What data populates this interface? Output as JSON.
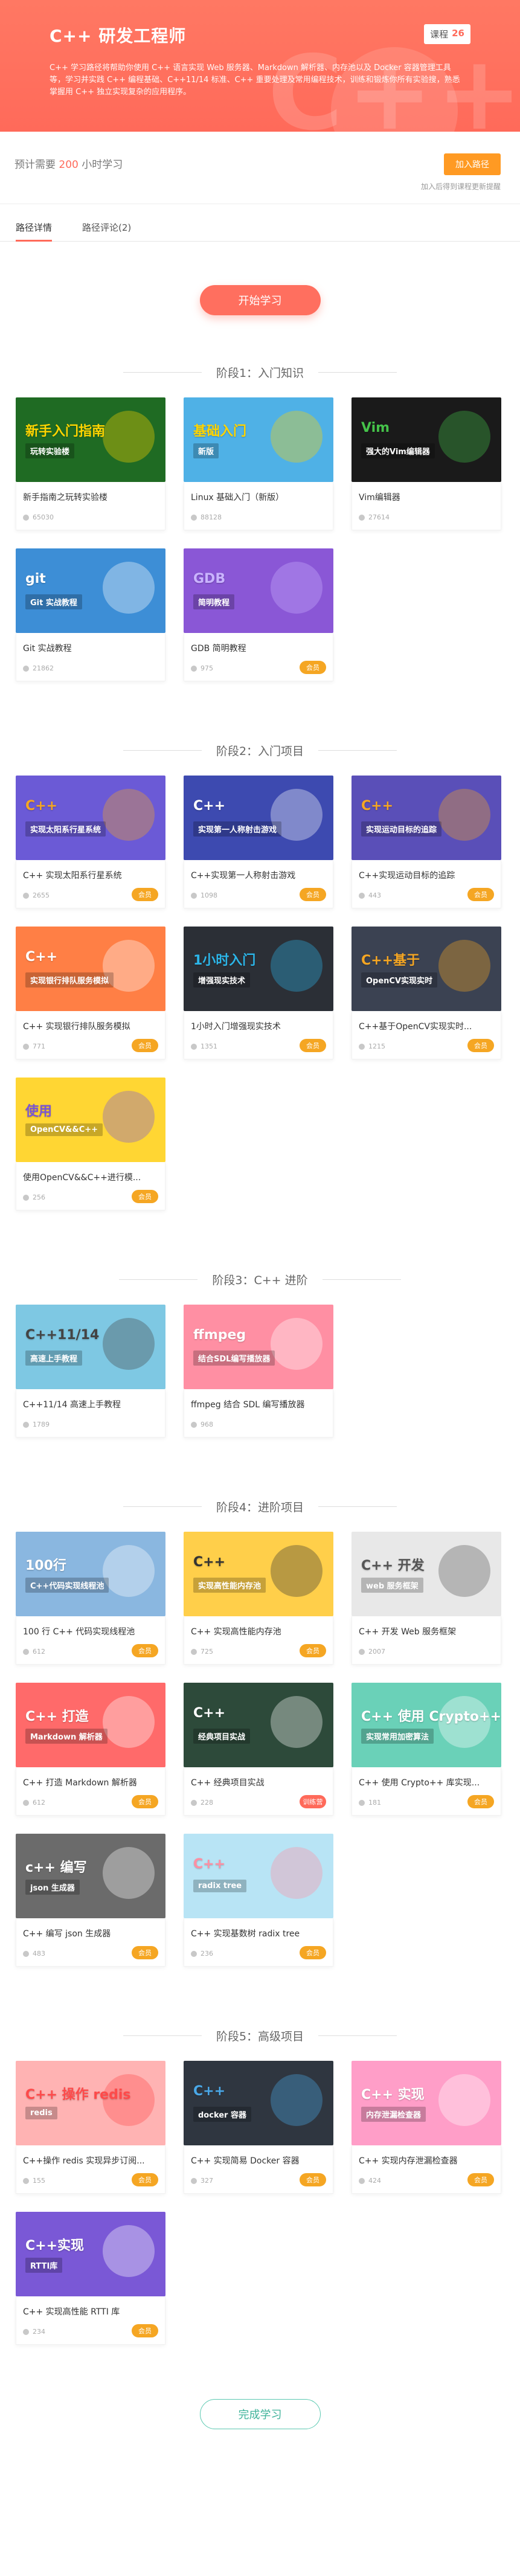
{
  "header": {
    "title": "C++ 研发工程师",
    "count_label": "课程",
    "count_value": "26",
    "description": "C++ 学习路径将帮助你使用 C++ 语言实现 Web 服务器、Markdown 解析器、内存池以及 Docker 容器管理工具等，学习并实践 C++ 编程基础、C++11/14 标准、C++ 重要处理及常用编程技术，训练和锻炼你所有实验搜，熟悉掌握用 C++ 独立实现复杂的应用程序。",
    "watermark": "C++"
  },
  "meta": {
    "estimate_prefix": "预计需要",
    "estimate_hours": "200",
    "estimate_suffix": "小时学习",
    "join_label": "加入路径",
    "join_note": "加入后得到课程更新提醒"
  },
  "tabs": [
    {
      "label": "路径详情",
      "active": true
    },
    {
      "label": "路径评论(2)",
      "active": false
    }
  ],
  "start_label": "开始学习",
  "done_label": "完成学习",
  "stages": [
    {
      "title": "阶段1：入门知识",
      "courses": [
        {
          "title": "新手指南之玩转实验楼",
          "users": "65030",
          "badge": "",
          "thumb": {
            "bg": "#1f6b23",
            "accent": "#ffd400",
            "text": "新手入门指南",
            "text2": "玩转实验楼"
          }
        },
        {
          "title": "Linux 基础入门（新版）",
          "users": "88128",
          "badge": "",
          "thumb": {
            "bg": "#4fb1e6",
            "accent": "#ffd400",
            "text": "基础入门",
            "text2": "新版"
          }
        },
        {
          "title": "Vim编辑器",
          "users": "27614",
          "badge": "",
          "thumb": {
            "bg": "#1a1a1a",
            "accent": "#45c24a",
            "text": "Vim",
            "text2": "强大的Vim编辑器"
          }
        },
        {
          "title": "Git 实战教程",
          "users": "21862",
          "badge": "",
          "thumb": {
            "bg": "#3d8ed6",
            "accent": "#ffffff",
            "text": "git",
            "text2": "Git 实战教程"
          }
        },
        {
          "title": "GDB 简明教程",
          "users": "975",
          "badge": "会员",
          "thumb": {
            "bg": "#8a57d6",
            "accent": "#c9b3ff",
            "text": "GDB",
            "text2": "简明教程"
          }
        }
      ]
    },
    {
      "title": "阶段2：入门项目",
      "courses": [
        {
          "title": "C++ 实现太阳系行星系统",
          "users": "2655",
          "badge": "会员",
          "thumb": {
            "bg": "#6b5ad6",
            "accent": "#f5a623",
            "text": "C++",
            "text2": "实现太阳系行星系统"
          }
        },
        {
          "title": "C++实现第一人称射击游戏",
          "users": "1098",
          "badge": "会员",
          "thumb": {
            "bg": "#3d4ab0",
            "accent": "#ffffff",
            "text": "C++",
            "text2": "实现第一人称射击游戏"
          }
        },
        {
          "title": "C++实现运动目标的追踪",
          "users": "443",
          "badge": "会员",
          "thumb": {
            "bg": "#5a4fb8",
            "accent": "#f5a623",
            "text": "C++",
            "text2": "实现运动目标的追踪"
          }
        },
        {
          "title": "C++ 实现银行排队服务模拟",
          "users": "771",
          "badge": "会员",
          "thumb": {
            "bg": "#ff7f45",
            "accent": "#ffffff",
            "text": "C++",
            "text2": "实现银行排队服务模拟"
          }
        },
        {
          "title": "1小时入门增强现实技术",
          "users": "1351",
          "badge": "会员",
          "thumb": {
            "bg": "#2b2f36",
            "accent": "#2cb5e8",
            "text": "1小时入门",
            "text2": "增强现实技术"
          }
        },
        {
          "title": "C++基于OpenCV实现实时...",
          "users": "1215",
          "badge": "会员",
          "thumb": {
            "bg": "#3b4252",
            "accent": "#f5a623",
            "text": "C++基于",
            "text2": "OpenCV实现实时"
          }
        },
        {
          "title": "使用OpenCV&&C++进行模...",
          "users": "256",
          "badge": "会员",
          "thumb": {
            "bg": "#ffd633",
            "accent": "#7a55d6",
            "text": "使用",
            "text2": "OpenCV&&C++"
          }
        }
      ]
    },
    {
      "title": "阶段3：C++ 进阶",
      "courses": [
        {
          "title": "C++11/14 高速上手教程",
          "users": "1789",
          "badge": "",
          "thumb": {
            "bg": "#7ec8e3",
            "accent": "#444444",
            "text": "C++11/14",
            "text2": "高速上手教程"
          }
        },
        {
          "title": "ffmpeg 结合 SDL 编写播放器",
          "users": "968",
          "badge": "",
          "thumb": {
            "bg": "#ff8fa3",
            "accent": "#ffffff",
            "text": "ffmpeg",
            "text2": "结合SDL编写播放器"
          }
        }
      ]
    },
    {
      "title": "阶段4：进阶项目",
      "courses": [
        {
          "title": "100 行 C++ 代码实现线程池",
          "users": "612",
          "badge": "会员",
          "thumb": {
            "bg": "#8ab7e0",
            "accent": "#ffffff",
            "text": "100行",
            "text2": "C++代码实现线程池"
          }
        },
        {
          "title": "C++ 实现高性能内存池",
          "users": "725",
          "badge": "会员",
          "thumb": {
            "bg": "#ffcf4a",
            "accent": "#333333",
            "text": "C++",
            "text2": "实现高性能内存池"
          }
        },
        {
          "title": "C++ 开发 Web 服务框架",
          "users": "2007",
          "badge": "",
          "thumb": {
            "bg": "#e8e8e8",
            "accent": "#555555",
            "text": "C++ 开发",
            "text2": "web 服务框架"
          }
        },
        {
          "title": "C++ 打造 Markdown 解析器",
          "users": "612",
          "badge": "会员",
          "thumb": {
            "bg": "#ff6a6a",
            "accent": "#ffffff",
            "text": "C++ 打造",
            "text2": "Markdown 解析器"
          }
        },
        {
          "title": "C++ 经典项目实战",
          "users": "228",
          "badge": "训练营",
          "thumb": {
            "bg": "#2d4a3a",
            "accent": "#ffffff",
            "text": "C++",
            "text2": "经典项目实战"
          }
        },
        {
          "title": "C++ 使用 Crypto++ 库实现...",
          "users": "181",
          "badge": "会员",
          "thumb": {
            "bg": "#6ad1b8",
            "accent": "#ffffff",
            "text": "C++ 使用 Crypto++ 库",
            "text2": "实现常用加密算法"
          }
        },
        {
          "title": "C++ 编写 json 生成器",
          "users": "483",
          "badge": "会员",
          "thumb": {
            "bg": "#6b6b6b",
            "accent": "#ffffff",
            "text": "c++ 编写",
            "text2": "json 生成器"
          }
        },
        {
          "title": "C++ 实现基数树 radix tree",
          "users": "236",
          "badge": "会员",
          "thumb": {
            "bg": "#b8e4f5",
            "accent": "#ff8fa3",
            "text": "C++",
            "text2": "radix tree"
          }
        }
      ]
    },
    {
      "title": "阶段5：高级项目",
      "courses": [
        {
          "title": "C++操作 redis 实现异步订阅...",
          "users": "155",
          "badge": "会员",
          "thumb": {
            "bg": "#ffb3b3",
            "accent": "#ff4a4a",
            "text": "C++ 操作 redis",
            "text2": "redis"
          }
        },
        {
          "title": "C++ 实现简易 Docker 容器",
          "users": "327",
          "badge": "会员",
          "thumb": {
            "bg": "#2f3640",
            "accent": "#4aa8e8",
            "text": "C++",
            "text2": "docker 容器"
          }
        },
        {
          "title": "C++ 实现内存泄漏检查器",
          "users": "424",
          "badge": "会员",
          "thumb": {
            "bg": "#ff9ec8",
            "accent": "#ffffff",
            "text": "C++ 实现",
            "text2": "内存泄漏检查器"
          }
        },
        {
          "title": "C++ 实现高性能 RTTI 库",
          "users": "234",
          "badge": "会员",
          "thumb": {
            "bg": "#7a58d6",
            "accent": "#ffffff",
            "text": "C++实现",
            "text2": "RTTI库"
          }
        }
      ]
    }
  ]
}
